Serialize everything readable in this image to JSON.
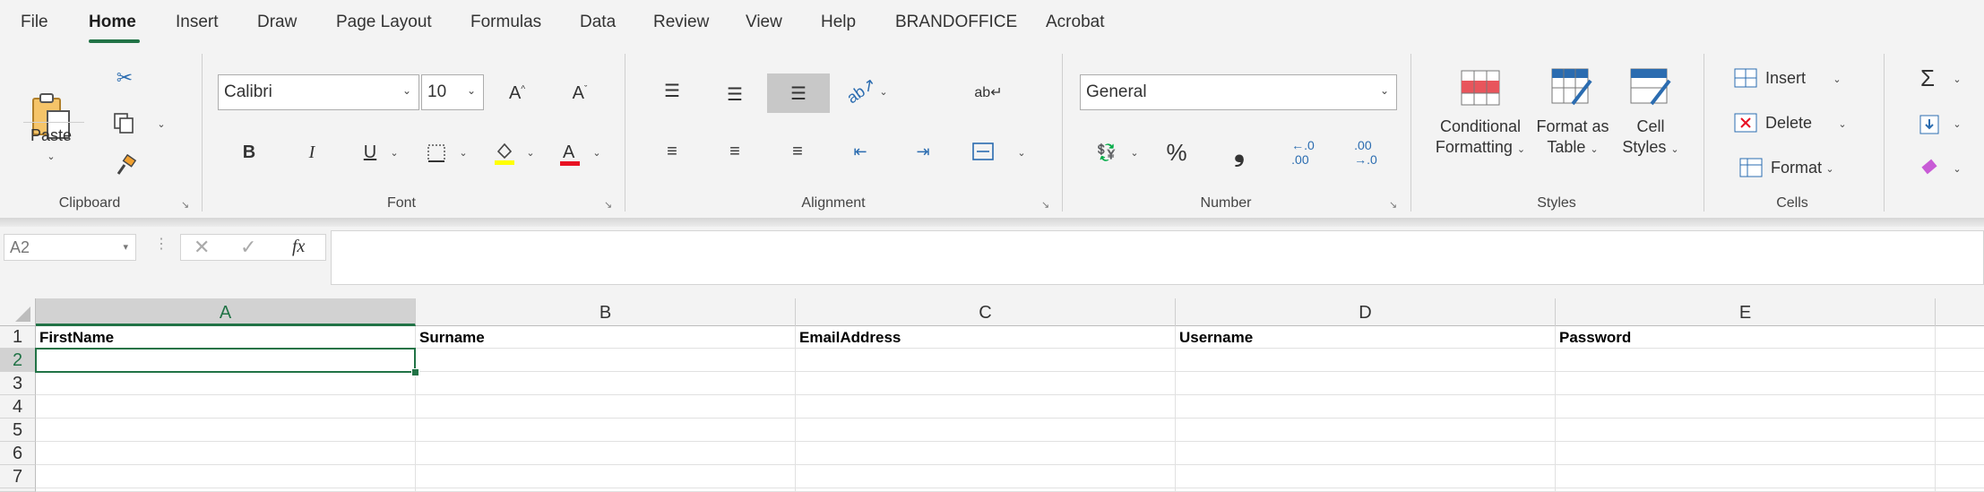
{
  "menu": {
    "tabs": [
      "File",
      "Home",
      "Insert",
      "Draw",
      "Page Layout",
      "Formulas",
      "Data",
      "Review",
      "View",
      "Help",
      "BRANDOFFICE",
      "Acrobat"
    ],
    "active": "Home"
  },
  "ribbon": {
    "clipboard": {
      "label": "Clipboard",
      "paste_label": "Paste"
    },
    "font": {
      "label": "Font",
      "font_name": "Calibri",
      "font_size": "10",
      "bold": "B",
      "italic": "I",
      "underline": "U"
    },
    "alignment": {
      "label": "Alignment"
    },
    "number": {
      "label": "Number",
      "format": "General",
      "percent": "%",
      "comma": "❟"
    },
    "styles": {
      "label": "Styles",
      "conditional_line1": "Conditional",
      "conditional_line2": "Formatting",
      "format_table_line1": "Format as",
      "format_table_line2": "Table",
      "cell_styles_line1": "Cell",
      "cell_styles_line2": "Styles"
    },
    "cells": {
      "label": "Cells",
      "insert": "Insert",
      "delete": "Delete",
      "format": "Format"
    },
    "editing": {
      "sum": "Σ"
    }
  },
  "formula_bar": {
    "name_box": "A2",
    "fx": "fx",
    "content": ""
  },
  "sheet": {
    "columns": [
      "A",
      "B",
      "C",
      "D",
      "E"
    ],
    "rows": [
      "1",
      "2",
      "3",
      "4",
      "5",
      "6",
      "7"
    ],
    "headers": [
      "FirstName",
      "Surname",
      "EmailAddress",
      "Username",
      "Password"
    ],
    "selected_cell": "A2"
  },
  "colors": {
    "accent": "#217346",
    "font_color": "#e81123",
    "highlight": "#ffff00"
  }
}
